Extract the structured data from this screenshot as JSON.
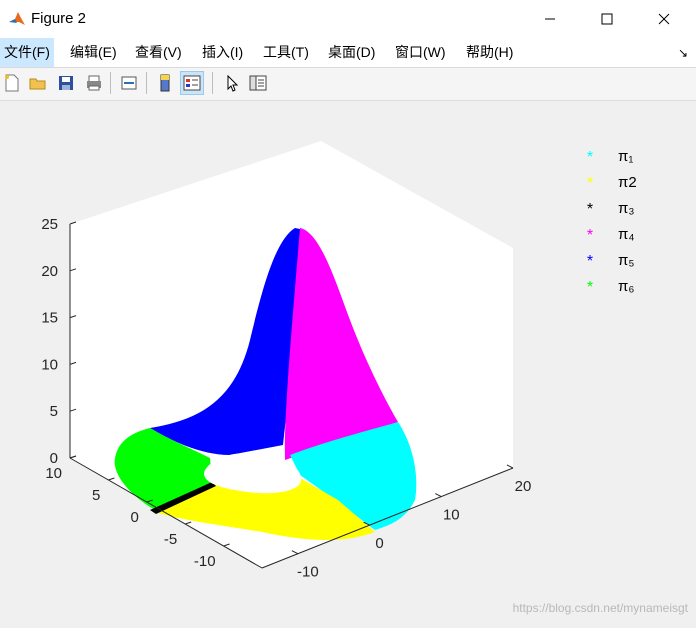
{
  "window": {
    "title": "Figure 2",
    "app_icon": "matlab-icon",
    "controls": [
      "minimize-icon",
      "maximize-icon",
      "close-icon"
    ]
  },
  "menu": {
    "items": [
      "文件(F)",
      "编辑(E)",
      "查看(V)",
      "插入(I)",
      "工具(T)",
      "桌面(D)",
      "窗口(W)",
      "帮助(H)"
    ],
    "extra_icon": "dock-arrow-icon"
  },
  "toolbar": {
    "buttons": [
      "new-figure-icon",
      "open-file-icon",
      "save-icon",
      "print-icon",
      "link-plot-icon",
      "colorbar-icon",
      "legend-icon",
      "pointer-icon",
      "plot-tools-icon"
    ]
  },
  "chart_data": {
    "type": "scatter",
    "title": "",
    "xlabel": "",
    "ylabel": "",
    "zlabel": "",
    "x_ticks": [
      "-10",
      "0",
      "10",
      "20"
    ],
    "y_ticks": [
      "-10",
      "-5",
      "0",
      "5",
      "10"
    ],
    "z_ticks": [
      "0",
      "5",
      "10",
      "15",
      "20",
      "25"
    ],
    "xlim": [
      -15,
      20
    ],
    "ylim": [
      -15,
      10
    ],
    "zlim": [
      0,
      25
    ],
    "legend_position": "top-right",
    "series": [
      {
        "name": "π₁",
        "color": "#00ffff",
        "marker": "*"
      },
      {
        "name": "π2",
        "color": "#ffff00",
        "marker": "*"
      },
      {
        "name": "π₃",
        "color": "#000000",
        "marker": "*"
      },
      {
        "name": "π₄",
        "color": "#ff00ff",
        "marker": "*"
      },
      {
        "name": "π₅",
        "color": "#0000ff",
        "marker": "*"
      },
      {
        "name": "π₆",
        "color": "#00ff00",
        "marker": "*"
      }
    ]
  },
  "watermark": "https://blog.csdn.net/mynameisgt"
}
